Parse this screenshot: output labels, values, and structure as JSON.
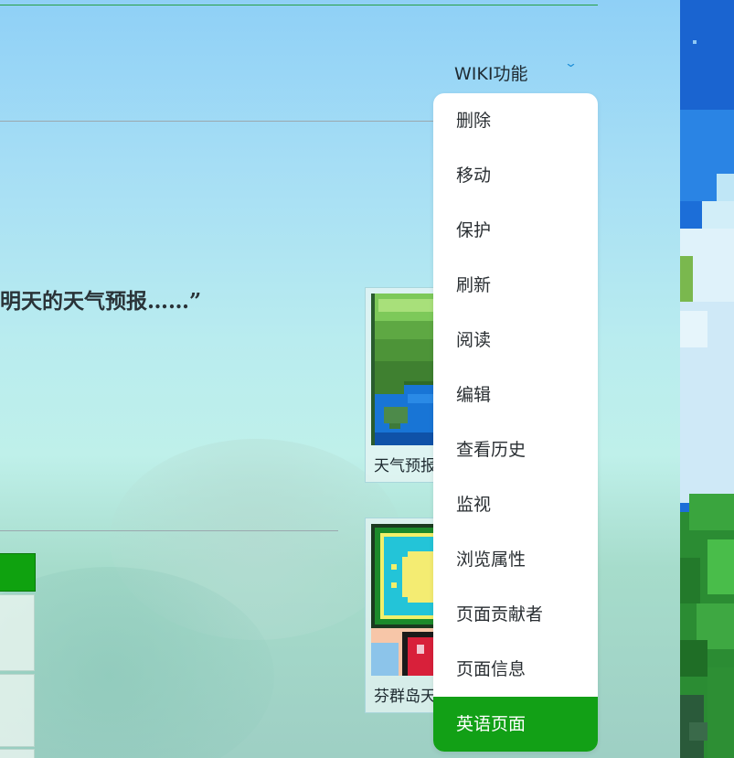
{
  "header": {
    "wiki_menu_label": "WIKI功能"
  },
  "content": {
    "quote_text": "明天的天气预报……”"
  },
  "thumbnails": [
    {
      "caption": "天气预报"
    },
    {
      "caption": "芬群岛天"
    }
  ],
  "menu": {
    "items": [
      {
        "label": "删除"
      },
      {
        "label": "移动"
      },
      {
        "label": "保护"
      },
      {
        "label": "刷新"
      },
      {
        "label": "阅读"
      },
      {
        "label": "编辑"
      },
      {
        "label": "查看历史"
      },
      {
        "label": "监视"
      },
      {
        "label": "浏览属性"
      },
      {
        "label": "页面贡献者"
      },
      {
        "label": "页面信息"
      },
      {
        "label": "英语页面"
      }
    ],
    "active_index": 11,
    "active_color": "#12a016"
  },
  "icons": {
    "dropdown": "chevron-down-icon"
  }
}
